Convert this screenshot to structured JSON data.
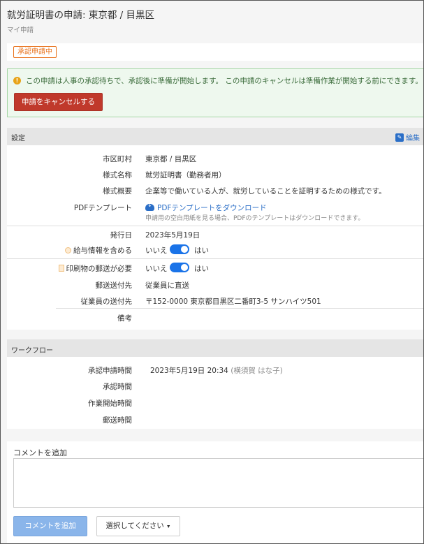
{
  "header": {
    "title": "就労証明書の申請: 東京都 / 目黒区",
    "breadcrumb": "マイ申請"
  },
  "status": {
    "badge": "承認申請中"
  },
  "alert": {
    "icon": "info-icon",
    "text": "この申請は人事の承認待ちで、承認後に準備が開始します。 この申請のキャンセルは準備作業が開始する前にできます。",
    "cancel_button": "申請をキャンセルする"
  },
  "settings": {
    "heading": "設定",
    "edit_label": "編集",
    "municipality_label": "市区町村",
    "municipality_value": "東京都 / 目黒区",
    "form_name_label": "様式名称",
    "form_name_value": "就労証明書（勤務者用）",
    "form_desc_label": "様式概要",
    "form_desc_value": "企業等で働いている人が、就労していることを証明するための様式です。",
    "pdf_label": "PDFテンプレート",
    "pdf_link": "PDFテンプレートをダウンロード",
    "pdf_note": "申請用の空白用紙を見る場合、PDFのテンプレートはダウンロードできます。",
    "issue_date_label": "発行日",
    "issue_date_value": "2023年5月19日",
    "salary_label": "給与情報を含める",
    "salary_off": "いいえ",
    "salary_on": "はい",
    "salary_enabled": true,
    "mail_label": "印刷物の郵送が必要",
    "mail_off": "いいえ",
    "mail_on": "はい",
    "mail_enabled": true,
    "mail_dest_label": "郵送送付先",
    "mail_dest_value": "従業員に直送",
    "employee_dest_label": "従業員の送付先",
    "employee_dest_value": "〒152-0000 東京都目黒区二番町3-5 サンハイツ501",
    "remarks_label": "備考",
    "remarks_value": ""
  },
  "workflow": {
    "heading": "ワークフロー",
    "requested_label": "承認申請時間",
    "requested_value": "2023年5月19日 20:34",
    "requested_by": "(横須賀 はな子)",
    "approved_label": "承認時間",
    "approved_value": "",
    "work_start_label": "作業開始時間",
    "work_start_value": "",
    "mailed_label": "郵送時間",
    "mailed_value": ""
  },
  "comment": {
    "label": "コメントを追加",
    "placeholder": "",
    "add_button": "コメントを追加",
    "select_button": "選択してください"
  },
  "colors": {
    "accent": "#2a6ec7",
    "danger": "#c0392b",
    "badge": "#e8711a",
    "toggle": "#1a73e8"
  }
}
